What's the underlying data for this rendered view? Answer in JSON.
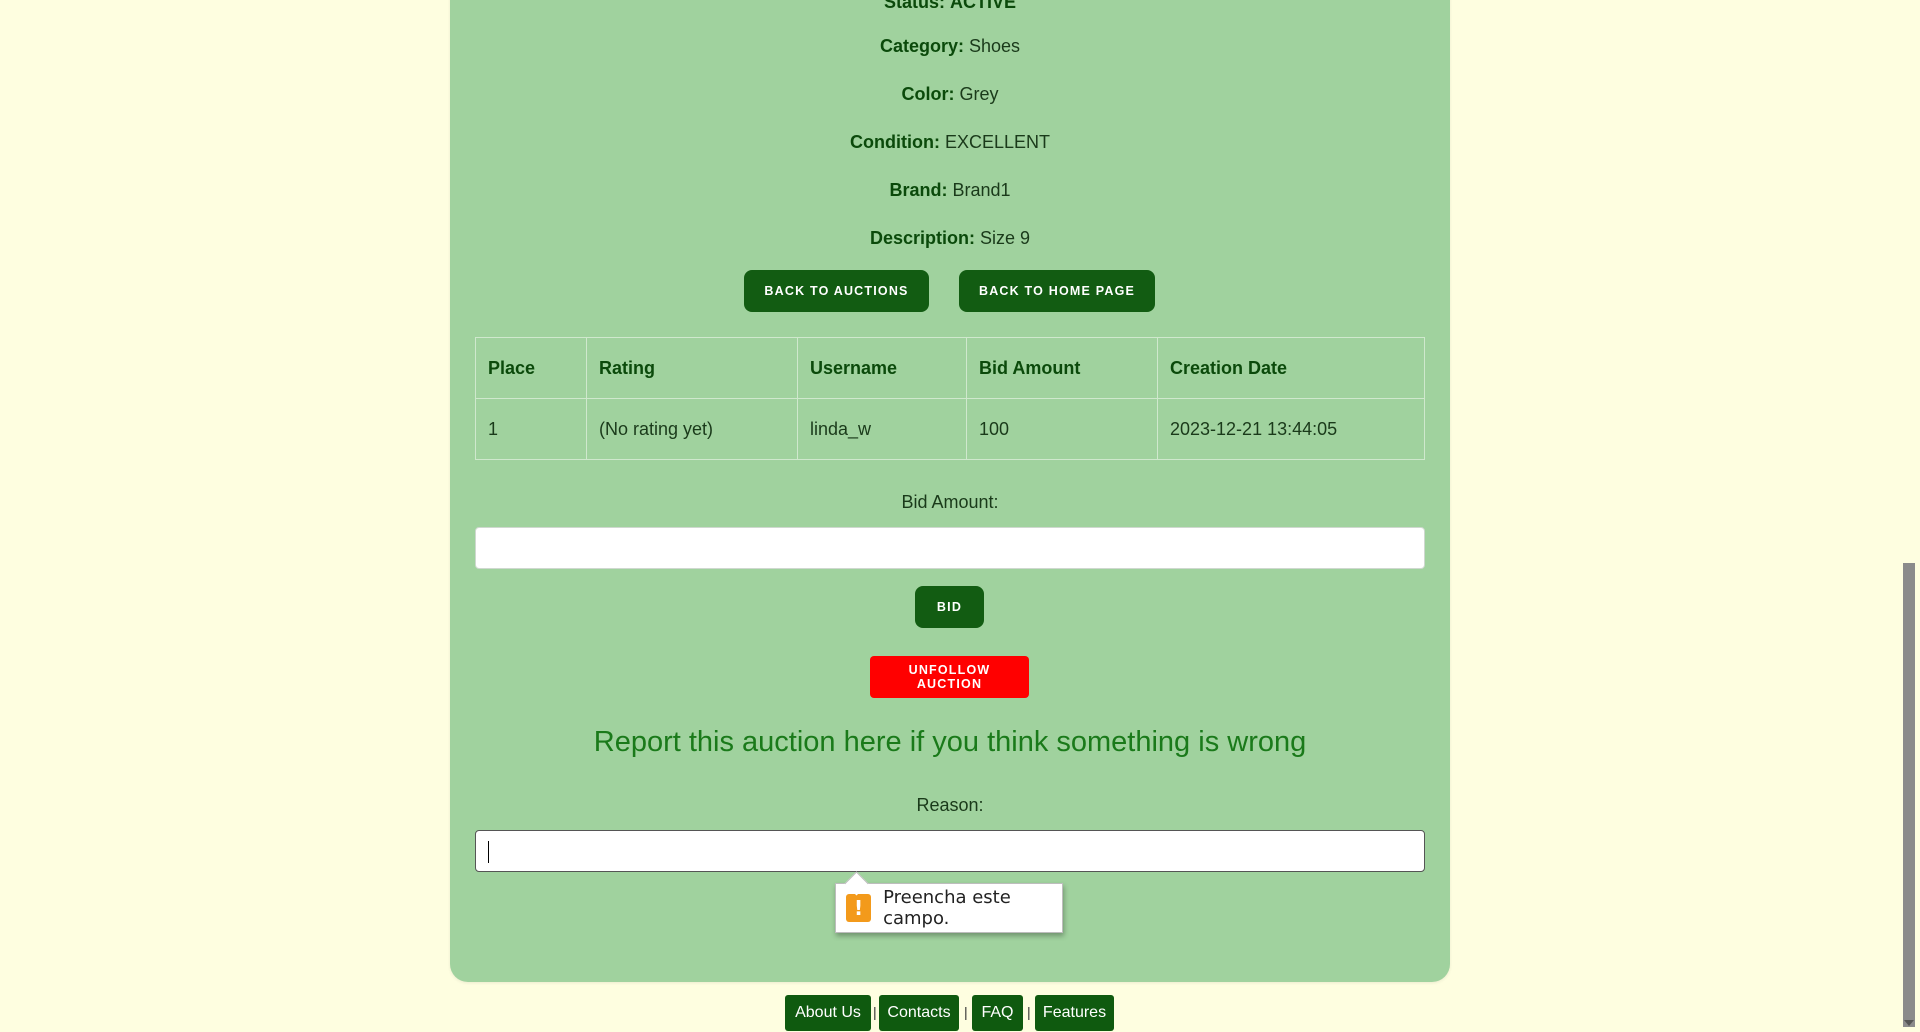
{
  "item_details": {
    "status_label": "Status:",
    "status_value": "ACTIVE",
    "category_label": "Category:",
    "category_value": "Shoes",
    "color_label": "Color:",
    "color_value": "Grey",
    "condition_label": "Condition:",
    "condition_value": "EXCELLENT",
    "brand_label": "Brand:",
    "brand_value": "Brand1",
    "description_label": "Description:",
    "description_value": "Size 9"
  },
  "buttons": {
    "back_to_auctions": "Back to Auctions",
    "back_to_home": "Back to Home Page",
    "bid": "Bid",
    "unfollow": "Unfollow Auction"
  },
  "bids_table": {
    "headers": [
      "Place",
      "Rating",
      "Username",
      "Bid Amount",
      "Creation Date"
    ],
    "rows": [
      [
        "1",
        "(No rating yet)",
        "linda_w",
        "100",
        "2023-12-21 13:44:05"
      ]
    ]
  },
  "bid_form": {
    "label": "Bid Amount:",
    "value": ""
  },
  "report": {
    "title": "Report this auction here if you think something is wrong",
    "reason_label": "Reason:",
    "reason_value": "",
    "validation_message": "Preencha este campo."
  },
  "footer": {
    "links": [
      "About Us",
      "Contacts",
      "FAQ",
      "Features"
    ],
    "separator": "|"
  },
  "colors": {
    "page_bg": "#fefee0",
    "card_bg": "#a0d29e",
    "button_dark": "#125c12",
    "button_danger": "#ff0000",
    "report_title": "#1a7a1a",
    "warning_icon": "#f39a1b"
  }
}
